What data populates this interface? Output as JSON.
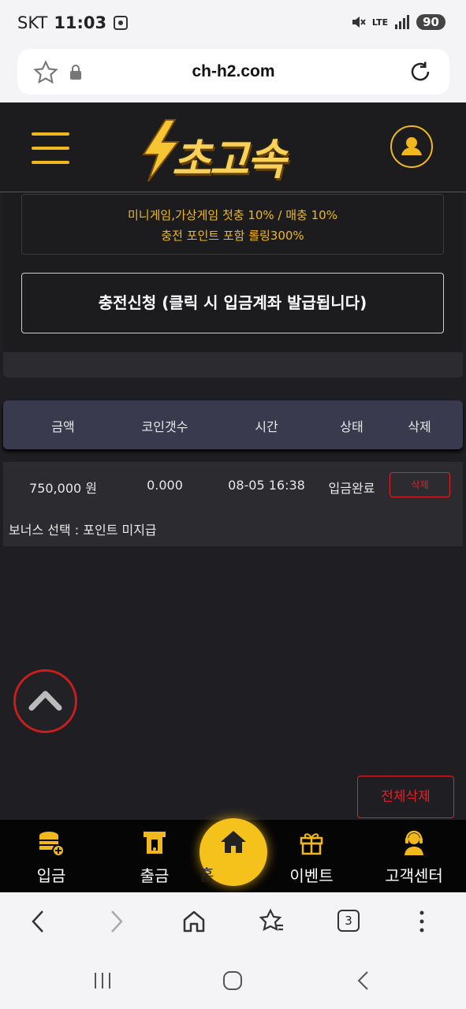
{
  "status_bar": {
    "carrier": "SKT",
    "time": "11:03",
    "network": "LTE",
    "battery": "90"
  },
  "browser": {
    "url": "ch-h2.com",
    "tab_count": "3"
  },
  "promo": {
    "line1": "미니게임,가상게임 첫충 10% / 매충 10%",
    "line2": "충전 포인트 포함 롤링300%"
  },
  "charge_button": "충전신청 (클릭 시 입금계좌 발급됩니다)",
  "table": {
    "headers": [
      "금액",
      "코인갯수",
      "시간",
      "상태",
      "삭제"
    ],
    "rows": [
      {
        "amount": "750,000 원",
        "coins": "0.000",
        "time": "08-05 16:38",
        "status": "입금완료",
        "delete": "삭제",
        "bonus": "보너스 선택 :  포인트 미지급"
      }
    ]
  },
  "delete_all": "전체삭제",
  "bottom_nav": [
    {
      "label": "입금",
      "icon": "coins-icon"
    },
    {
      "label": "출금",
      "icon": "withdraw-icon"
    },
    {
      "label": "홈",
      "icon": "home-icon"
    },
    {
      "label": "이벤트",
      "icon": "gift-icon"
    },
    {
      "label": "고객센터",
      "icon": "support-icon"
    }
  ],
  "colors": {
    "accent_gold": "#f0b81c",
    "danger_red": "#e0202a",
    "background": "#1f1f23"
  }
}
